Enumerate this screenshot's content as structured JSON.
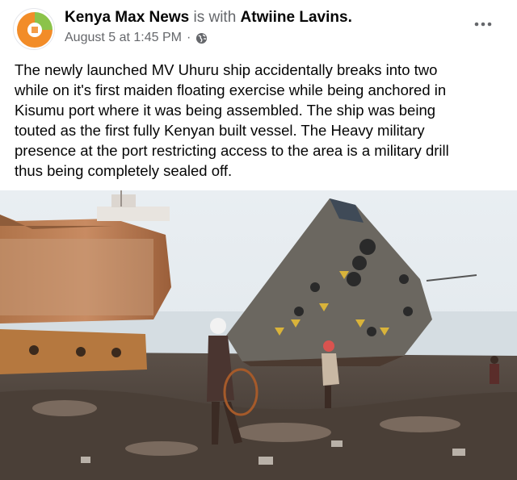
{
  "post": {
    "author": "Kenya Max News",
    "with_text": "is with",
    "tagged": "Atwiine Lavins.",
    "timestamp": "August 5 at 1:45 PM",
    "separator": "·",
    "privacy_icon": "globe-icon",
    "more_icon": "more-options-icon",
    "text": "The newly launched MV Uhuru ship accidentally breaks into two\nwhile on it's first maiden floating exercise while being anchored in\nKisumu port where it was being assembled. The ship was being\ntouted as the first fully Kenyan built vessel. The Heavy military\npresence at the port restricting access to the area is a military drill\nthus being completely sealed off."
  },
  "colors": {
    "text_primary": "#050505",
    "text_secondary": "#65676b",
    "avatar_orange": "#f28c28",
    "avatar_green": "#8bc34a"
  }
}
